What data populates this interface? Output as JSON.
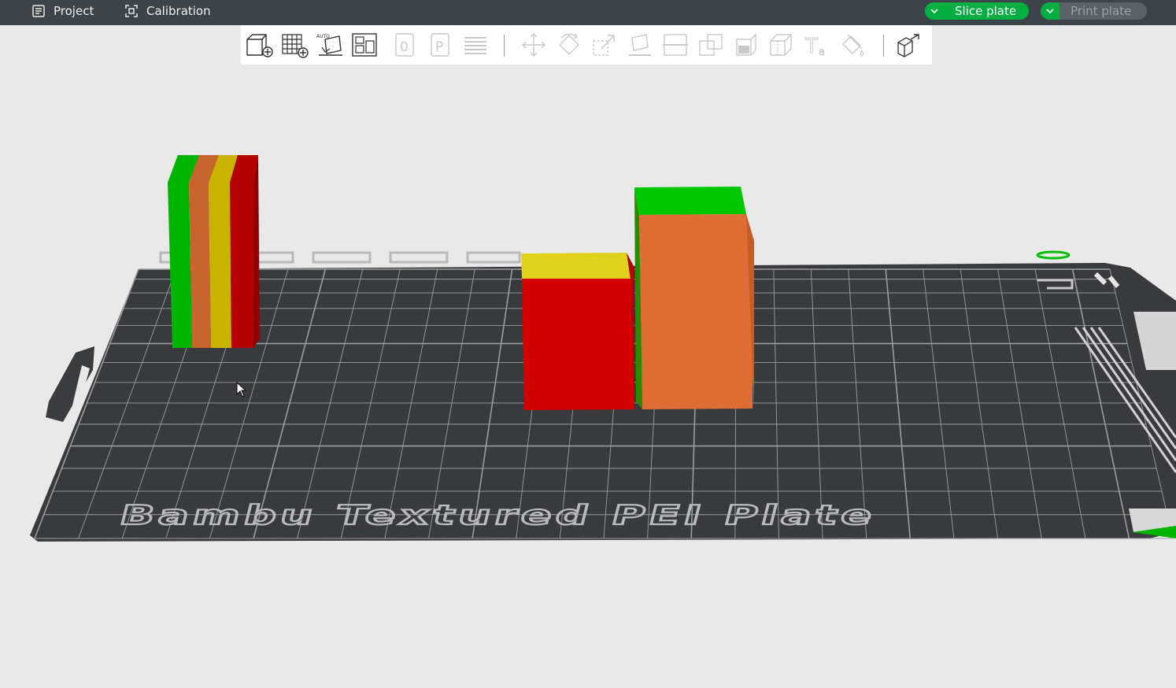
{
  "topbar": {
    "project_label": "Project",
    "calibration_label": "Calibration",
    "slice_label": "Slice plate",
    "print_label": "Print plate",
    "colors": {
      "bar": "#3d4449",
      "accent": "#00ae42",
      "disabled": "#5b6166"
    }
  },
  "toolbar": {
    "icons": [
      "add-object-icon",
      "add-plate-icon",
      "auto-orient-icon",
      "arrange-icon",
      "split-objects-icon",
      "split-parts-icon",
      "layers-icon",
      "move-icon",
      "rotate-icon",
      "scale-icon",
      "lay-on-face-icon",
      "cut-icon",
      "boolean-icon",
      "support-paint-icon",
      "seam-paint-icon",
      "text-icon",
      "color-paint-icon",
      "assembly-view-icon"
    ]
  },
  "plate": {
    "label": "Bambu Textured PEI Plate",
    "colors": {
      "bed": "#383a3e",
      "grid": "#9a9c9e",
      "text": "#b9babc"
    }
  },
  "objects": {
    "colors": [
      "#00b400",
      "#c8642d",
      "#c8b400",
      "#b40000",
      "#d40000",
      "#dd6c35",
      "#e0d21a"
    ]
  }
}
